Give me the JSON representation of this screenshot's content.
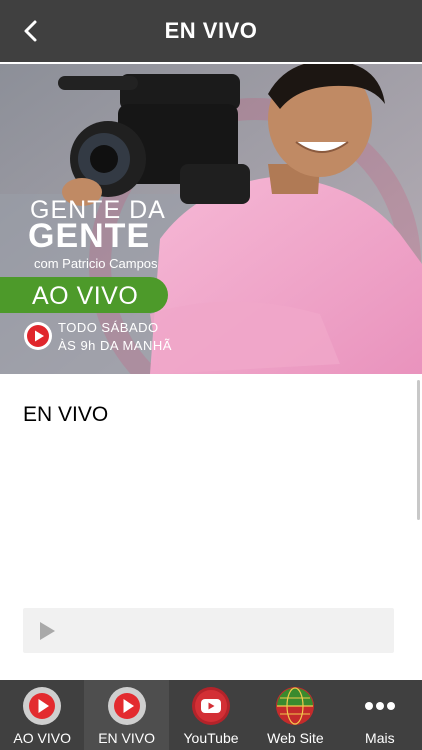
{
  "header": {
    "title": "EN VIVO",
    "back_icon": "chevron-left-icon"
  },
  "banner": {
    "line1": "GENTE DA",
    "line2": "GENTE",
    "host": "com Patricio Campos",
    "live_label": "AO VIVO",
    "schedule_line1": "TODO SÁBADO",
    "schedule_line2": "ÀS 9h DA MANHÃ",
    "accent_color": "#4d9a2a"
  },
  "main": {
    "heading": "EN VIVO",
    "player": {
      "play_icon": "play-icon"
    }
  },
  "tabbar": {
    "items": [
      {
        "label": "AO VIVO",
        "icon": "play-circle-icon",
        "active": false
      },
      {
        "label": "EN VIVO",
        "icon": "play-circle-icon",
        "active": true
      },
      {
        "label": "YouTube",
        "icon": "youtube-icon",
        "active": false
      },
      {
        "label": "Web Site",
        "icon": "globe-icon",
        "active": false
      },
      {
        "label": "Mais",
        "icon": "more-icon",
        "active": false
      }
    ]
  }
}
